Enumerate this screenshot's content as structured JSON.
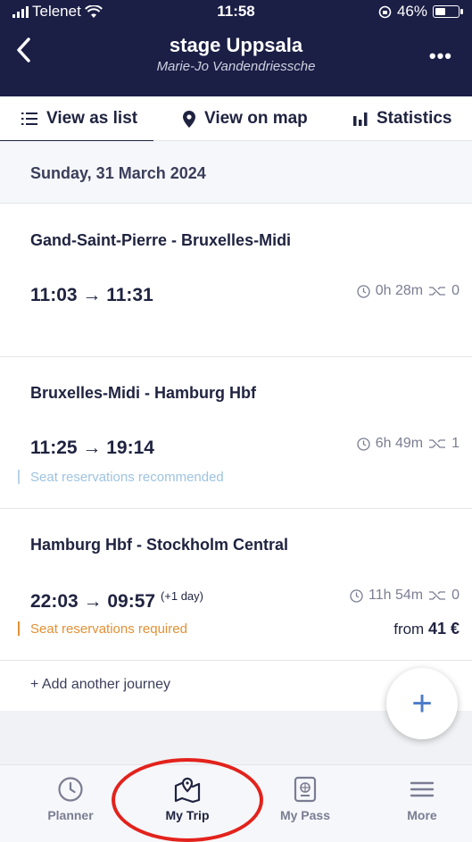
{
  "status_bar": {
    "carrier": "Telenet",
    "time": "11:58",
    "battery": "46%",
    "battery_level": 0.46
  },
  "header": {
    "title": "stage Uppsala",
    "subtitle": "Marie-Jo Vandendriessche"
  },
  "tabs": [
    {
      "label": "View as list",
      "icon": "list-icon",
      "active": true
    },
    {
      "label": "View on map",
      "icon": "map-pin-icon",
      "active": false
    },
    {
      "label": "Statistics",
      "icon": "bar-chart-icon",
      "active": false
    }
  ],
  "date_header": "Sunday, 31 March 2024",
  "journeys": [
    {
      "route": "Gand-Saint-Pierre - Bruxelles-Midi",
      "times": "11:03 → 11:31",
      "day_offset": "",
      "duration": "0h 28m",
      "transfers": "0",
      "note": "",
      "price_prefix": "",
      "price": ""
    },
    {
      "route": "Bruxelles-Midi - Hamburg Hbf",
      "times": "11:25 → 19:14",
      "day_offset": "",
      "duration": "6h 49m",
      "transfers": "1",
      "note": "Seat reservations recommended",
      "price_prefix": "",
      "price": ""
    },
    {
      "route": "Hamburg Hbf - Stockholm Central",
      "times": "22:03 → 09:57",
      "day_offset": "(+1 day)",
      "duration": "11h 54m",
      "transfers": "0",
      "note": "Seat reservations required",
      "price_prefix": "from",
      "price": "41 €"
    }
  ],
  "add_journey": "+ Add another journey",
  "fab_label": "+",
  "bottom_nav": [
    {
      "label": "Planner",
      "icon": "clock-icon",
      "active": false
    },
    {
      "label": "My Trip",
      "icon": "map-trip-icon",
      "active": true
    },
    {
      "label": "My Pass",
      "icon": "passport-icon",
      "active": false
    },
    {
      "label": "More",
      "icon": "menu-icon",
      "active": false
    }
  ],
  "colors": {
    "header_bg": "#1b1e45",
    "accent": "#4a7bc8",
    "required": "#e39034",
    "recommended": "#9ec3e0",
    "highlight": "#e3221c"
  }
}
